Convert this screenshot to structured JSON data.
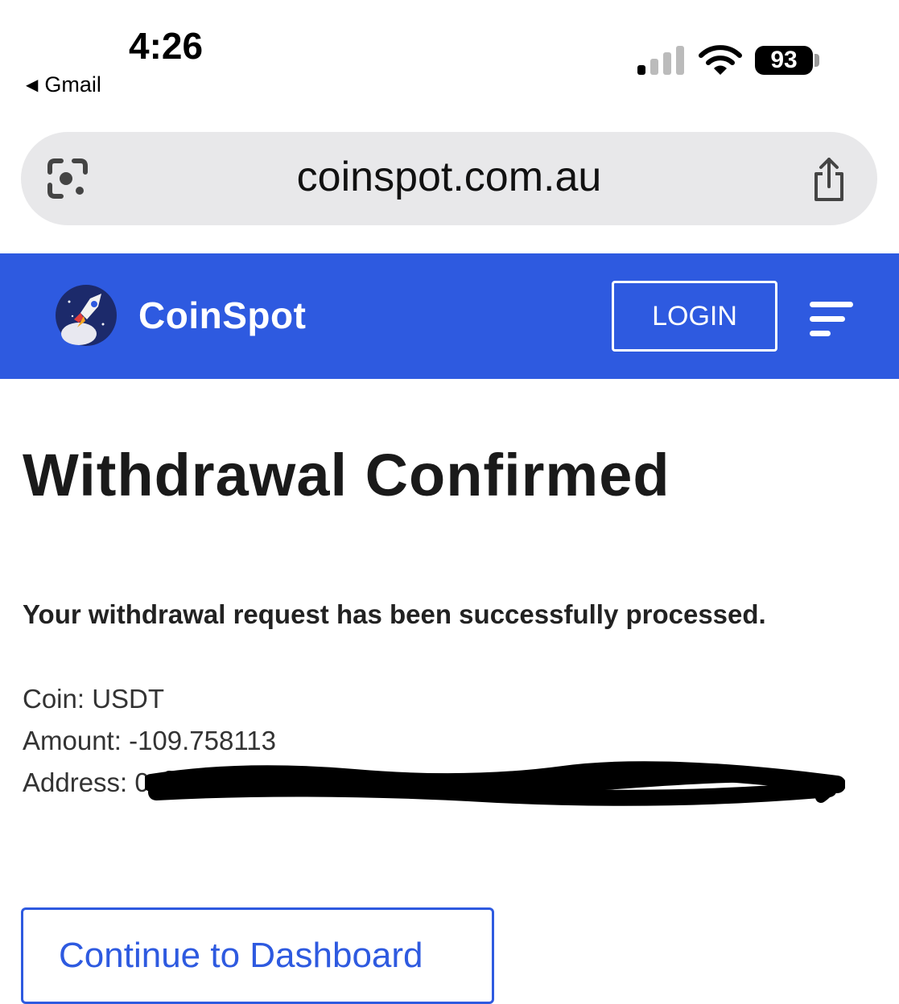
{
  "status_bar": {
    "time": "4:26",
    "back_app": "Gmail",
    "battery": "93"
  },
  "browser": {
    "url": "coinspot.com.au"
  },
  "header": {
    "brand": "CoinSpot",
    "login_label": "LOGIN"
  },
  "content": {
    "title": "Withdrawal Confirmed",
    "message": "Your withdrawal request has been successfully processed.",
    "coin_label": "Coin:",
    "coin_value": "USDT",
    "amount_label": "Amount:",
    "amount_value": "-109.758113",
    "address_label": "Address:",
    "address_value": "0"
  },
  "actions": {
    "dashboard_label": "Continue to Dashboard"
  },
  "colors": {
    "brand_blue": "#2e5ae0",
    "url_bar_bg": "#e8e8ea"
  },
  "icons": [
    "signal-icon",
    "wifi-icon",
    "battery-icon",
    "google-lens-icon",
    "share-icon",
    "rocket-logo-icon",
    "hamburger-menu-icon"
  ]
}
